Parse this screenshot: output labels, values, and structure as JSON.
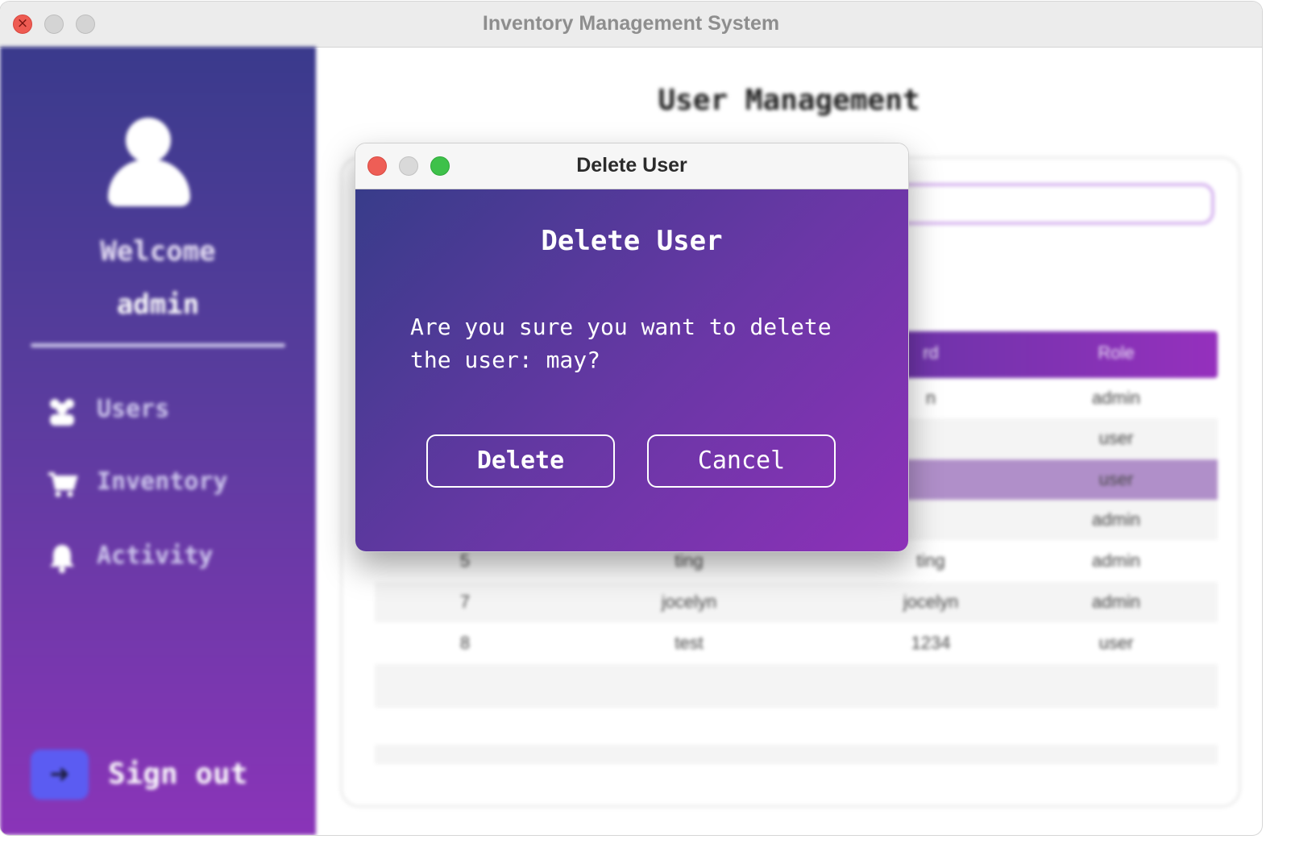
{
  "window": {
    "title": "Inventory Management System"
  },
  "sidebar": {
    "welcome": "Welcome",
    "username": "admin",
    "items": [
      {
        "label": "Users",
        "icon": "users-icon"
      },
      {
        "label": "Inventory",
        "icon": "cart-icon"
      },
      {
        "label": "Activity",
        "icon": "bell-icon"
      }
    ],
    "signout_label": "Sign out"
  },
  "content": {
    "title": "User Management",
    "table": {
      "headers": [
        "",
        "",
        "rd",
        "Role"
      ],
      "rows": [
        [
          "",
          "",
          "n",
          "admin"
        ],
        [
          "",
          "",
          "",
          "user"
        ],
        [
          "",
          "",
          "",
          "user"
        ],
        [
          "",
          "",
          "",
          "admin"
        ],
        [
          "5",
          "ting",
          "ting",
          "admin"
        ],
        [
          "7",
          "jocelyn",
          "jocelyn",
          "admin"
        ],
        [
          "8",
          "test",
          "1234",
          "user"
        ]
      ],
      "selected_row": 2
    }
  },
  "dialog": {
    "window_title": "Delete User",
    "heading": "Delete User",
    "message": "Are you sure you want to delete the user: may?",
    "delete_label": "Delete",
    "cancel_label": "Cancel"
  },
  "colors": {
    "accent_start": "#3a3a8c",
    "accent_end": "#8d31b8",
    "signout_button": "#5b5cf2"
  }
}
